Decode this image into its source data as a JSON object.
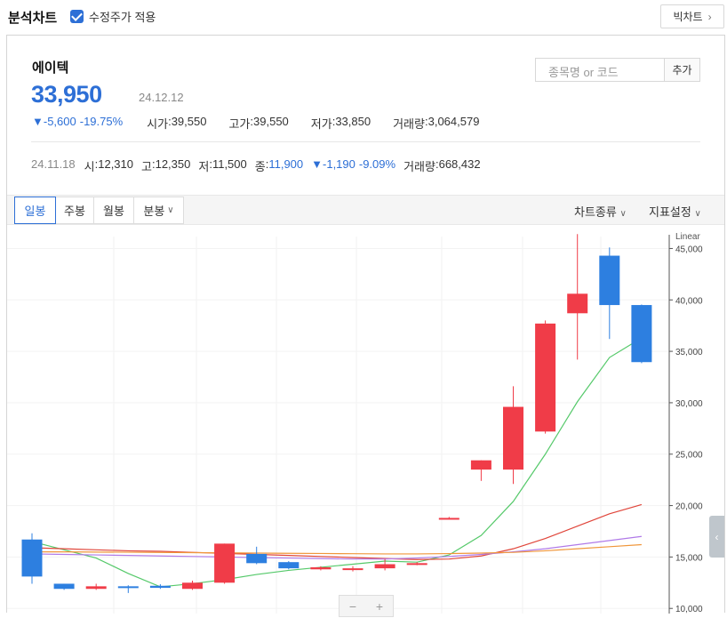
{
  "header": {
    "title": "분석차트",
    "adjusted_label": "수정주가 적용",
    "adjusted_checked": true,
    "big_chart_label": "빅차트"
  },
  "stock": {
    "name": "에이텍",
    "price": "33,950",
    "date": "24.12.12",
    "change": "▼-5,600",
    "change_pct": "-19.75%",
    "open_label": "시가",
    "open": "39,550",
    "high_label": "고가",
    "high": "39,550",
    "low_label": "저가",
    "low": "33,850",
    "volume_label": "거래량",
    "volume": "3,064,579"
  },
  "search": {
    "placeholder": "종목명 or 코드",
    "add_label": "추가"
  },
  "hover": {
    "date": "24.11.18",
    "o_label": "시",
    "o": "12,310",
    "h_label": "고",
    "h": "12,350",
    "l_label": "저",
    "l": "11,500",
    "c_label": "종",
    "c": "11,900",
    "change": "▼-1,190",
    "change_pct": "-9.09%",
    "vol_label": "거래량",
    "vol": "668,432"
  },
  "tabs": [
    "일봉",
    "주봉",
    "월봉",
    "분봉"
  ],
  "right_menu": {
    "chart_type": "차트종류",
    "indicator": "지표설정"
  },
  "colors": {
    "up": "#f03c48",
    "down": "#2d7fe0",
    "accent": "#2d6fd6"
  },
  "chart_data": {
    "type": "candlestick",
    "scale_label": "Linear",
    "y_ticks": [
      "45,000",
      "40,000",
      "35,000",
      "30,000",
      "25,000",
      "20,000",
      "15,000",
      "10,000"
    ],
    "y_tick_values": [
      45000,
      40000,
      35000,
      30000,
      25000,
      20000,
      15000,
      10000
    ],
    "ylim": [
      9500,
      47200
    ],
    "candles": [
      {
        "o": 16700,
        "h": 17300,
        "l": 12400,
        "c": 13100
      },
      {
        "o": 12400,
        "h": 12400,
        "l": 11800,
        "c": 11900
      },
      {
        "o": 11900,
        "h": 12400,
        "l": 11800,
        "c": 12150
      },
      {
        "o": 12150,
        "h": 12250,
        "l": 11500,
        "c": 12100
      },
      {
        "o": 12200,
        "h": 12350,
        "l": 11900,
        "c": 12000
      },
      {
        "o": 11900,
        "h": 12700,
        "l": 11800,
        "c": 12500
      },
      {
        "o": 12500,
        "h": 16300,
        "l": 12400,
        "c": 16300
      },
      {
        "o": 15300,
        "h": 16000,
        "l": 14300,
        "c": 14400
      },
      {
        "o": 14500,
        "h": 14600,
        "l": 13800,
        "c": 13900
      },
      {
        "o": 13800,
        "h": 14100,
        "l": 13700,
        "c": 14000
      },
      {
        "o": 13800,
        "h": 14100,
        "l": 13600,
        "c": 13900
      },
      {
        "o": 13900,
        "h": 14800,
        "l": 13700,
        "c": 14300
      },
      {
        "o": 14300,
        "h": 14500,
        "l": 14200,
        "c": 14400
      },
      {
        "o": 18800,
        "h": 18900,
        "l": 18700,
        "c": 18800
      },
      {
        "o": 23500,
        "h": 24400,
        "l": 22400,
        "c": 24400
      },
      {
        "o": 23500,
        "h": 31600,
        "l": 22100,
        "c": 29600
      },
      {
        "o": 27200,
        "h": 38000,
        "l": 27000,
        "c": 37700
      },
      {
        "o": 38700,
        "h": 46400,
        "l": 34200,
        "c": 40600
      },
      {
        "o": 44300,
        "h": 45100,
        "l": 36200,
        "c": 39500
      },
      {
        "o": 39500,
        "h": 39550,
        "l": 33850,
        "c": 33950
      }
    ],
    "ma_lines": [
      {
        "color": "#55c96a",
        "values": [
          16500,
          15700,
          14900,
          13400,
          12100,
          12400,
          12800,
          13300,
          13700,
          14000,
          14300,
          14600,
          14500,
          15200,
          17100,
          20400,
          25000,
          30100,
          34400,
          36300
        ]
      },
      {
        "color": "#e0453a",
        "values": [
          15900,
          15800,
          15700,
          15600,
          15550,
          15450,
          15350,
          15250,
          15150,
          15050,
          14950,
          14850,
          14750,
          14800,
          15100,
          15800,
          16800,
          18000,
          19200,
          20100
        ]
      },
      {
        "color": "#b07ae8",
        "values": [
          15300,
          15250,
          15200,
          15150,
          15100,
          15050,
          15000,
          14950,
          14900,
          14850,
          14800,
          14800,
          14900,
          15050,
          15250,
          15500,
          15800,
          16200,
          16600,
          17000
        ]
      },
      {
        "color": "#f0963a",
        "values": [
          15500,
          15500,
          15480,
          15460,
          15440,
          15420,
          15400,
          15380,
          15360,
          15340,
          15320,
          15300,
          15300,
          15330,
          15380,
          15450,
          15600,
          15800,
          16000,
          16200
        ]
      }
    ]
  }
}
